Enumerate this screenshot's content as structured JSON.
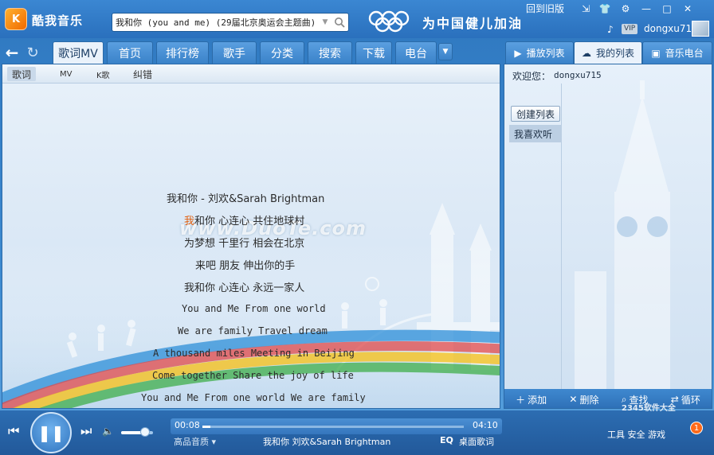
{
  "app": {
    "logo_text": "K",
    "title": "酷我音乐"
  },
  "search": {
    "value": "我和你 (you and me) (29届北京奥运会主题曲)"
  },
  "header": {
    "slogan": "为中国健儿加油",
    "old_version": "回到旧版",
    "vip": "VIP",
    "username": "dongxu715"
  },
  "nav": {
    "tabs": [
      "歌词MV",
      "首页",
      "排行榜",
      "歌手",
      "分类",
      "搜索",
      "下载",
      "电台"
    ],
    "active": 0
  },
  "right_tabs": {
    "tabs": [
      "播放列表",
      "我的列表",
      "音乐电台"
    ],
    "active": 1
  },
  "subtabs": {
    "items": [
      "歌词",
      "MV",
      "K歌",
      "纠错"
    ],
    "active": 0
  },
  "lyrics": {
    "lines": [
      {
        "text": "我和你 - 刘欢&Sarah Brightman",
        "lang": "zh"
      },
      {
        "sung": "我",
        "rest": "和你 心连心 共住地球村",
        "lang": "zh"
      },
      {
        "text": "为梦想 千里行 相会在北京",
        "lang": "zh"
      },
      {
        "text": "来吧 朋友 伸出你的手",
        "lang": "zh"
      },
      {
        "text": "我和你 心连心 永远一家人",
        "lang": "zh"
      },
      {
        "text": "You and Me From one world",
        "lang": "en"
      },
      {
        "text": "We are family Travel dream",
        "lang": "en"
      },
      {
        "text": "A thousand miles Meeting in Beijing",
        "lang": "en"
      },
      {
        "text": "Come together Share the joy of life",
        "lang": "en"
      },
      {
        "text": "You and Me From one world We are family",
        "lang": "en"
      }
    ]
  },
  "watermark": "www.DuoTe.com",
  "playlist_panel": {
    "welcome": "欢迎您：",
    "user": "dongxu715",
    "create_list": "创建列表",
    "favorite": "我喜欢听",
    "footer": {
      "add": "添加",
      "delete": "删除",
      "find": "查找",
      "loop": "循环"
    }
  },
  "player": {
    "time_current": "00:08",
    "time_total": "04:10",
    "progress": 0.032,
    "volume": 0.75,
    "quality": "高品音质",
    "now_playing": "我和你  刘欢&Sarah  Brightman",
    "eq": "EQ",
    "desktop_lyrics": "桌面歌词",
    "toolbox": "工具  安全  游戏",
    "game_badge": "1",
    "site_mark": "2345软件大全"
  },
  "colors": {
    "brand_blue": "#2f78c0",
    "highlight": "#e06010",
    "rings": [
      "#0b6bc3",
      "#222222",
      "#d7263d",
      "#f2b705",
      "#2aa34a"
    ]
  }
}
